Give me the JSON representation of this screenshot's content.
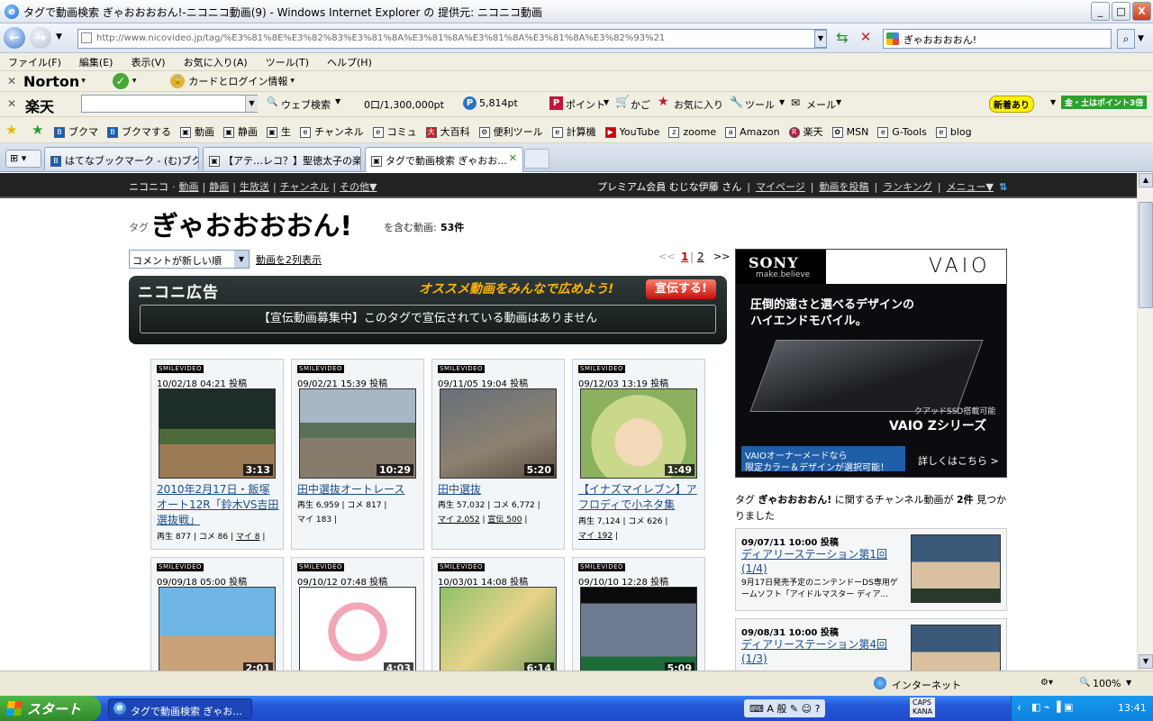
{
  "window": {
    "title": "タグで動画検索 ぎゃおおおおん!-ニコニコ動画(9) - Windows Internet Explorer の 提供元: ニコニコ動画",
    "minimize": "_",
    "maximize": "□",
    "close": "X"
  },
  "address": {
    "url": "http://www.nicovideo.jp/tag/%E3%81%8E%E3%82%83%E3%81%8A%E3%81%8A%E3%81%8A%E3%81%8A%E3%82%93%21",
    "search_value": "ぎゃおおおおん!"
  },
  "menu": [
    "ファイル(F)",
    "編集(E)",
    "表示(V)",
    "お気に入り(A)",
    "ツール(T)",
    "ヘルプ(H)"
  ],
  "norton_bar": {
    "brand": "Norton",
    "card_label": "カードとログイン情報"
  },
  "rakuten_bar": {
    "brand": "楽天",
    "web_search": "ウェブ検索",
    "points": "0口/1,300,000pt",
    "pt": "5,814pt",
    "point_label": "ポイント",
    "cart": "かご",
    "favorites": "お気に入り",
    "tools": "ツール",
    "mail": "メール",
    "new_badge": "新着あり",
    "promo": "金・土はポイント3倍"
  },
  "favorites_bar": [
    "ブクマ",
    "ブクマする",
    "動画",
    "静画",
    "生",
    "チャンネル",
    "コミュ",
    "大百科",
    "便利ツール",
    "計算機",
    "YouTube",
    "zoome",
    "Amazon",
    "楽天",
    "MSN",
    "G-Tools",
    "blog"
  ],
  "tabs": [
    {
      "label": "はてなブックマーク - (む)ブクマ..."
    },
    {
      "label": "【アテ…レコ？】聖徳太子の楽..."
    },
    {
      "label": "タグで動画検索 ぎゃおお..."
    }
  ],
  "site_nav": {
    "left": [
      "ニコニコ",
      "動画",
      "静画",
      "生放送",
      "チャンネル",
      "その他▼"
    ],
    "user_text": "プレミアム会員 むじな伊藤 さん",
    "right": [
      "マイページ",
      "動画を投稿",
      "ランキング",
      "メニュー▼"
    ]
  },
  "tag_header": {
    "prefix": "タグ",
    "tag": "ぎゃおおおおん!",
    "count_label": "を含む動画:",
    "count": "53件"
  },
  "controls": {
    "sort_selected": "コメントが新しい順",
    "two_column": "動画を2列表示",
    "pager_prev": "<<",
    "pages": [
      "1",
      "2"
    ],
    "pager_next": ">>"
  },
  "ad_banner": {
    "heading": "ニコニ広告",
    "promo": "オススメ動画をみんなで広めよう!",
    "send_button": "宣伝する!",
    "message": "【宣伝動画募集中】このタグで宣伝されている動画はありません"
  },
  "badge_text": "SMILEVIDEO",
  "videos_row1": [
    {
      "date": "10/02/18 04:21 投稿",
      "length": "3:13",
      "title": "2010年2月17日・飯塚オート12R「鈴木VS吉田選抜戦」",
      "stats": [
        "再生 877",
        "コメ 86",
        "マイ 8"
      ],
      "thumb": "race"
    },
    {
      "date": "09/02/21 15:39 投稿",
      "length": "10:29",
      "title": "田中選抜オートレース",
      "stats": [
        "再生 6,959",
        "コメ 817",
        "マイ 183"
      ],
      "thumb": "track"
    },
    {
      "date": "09/11/05 19:04 投稿",
      "length": "5:20",
      "title": "田中選抜",
      "stats": [
        "再生 57,032",
        "コメ 6,772",
        "マイ 2,052",
        "宣伝 500"
      ],
      "thumb": "race"
    },
    {
      "date": "09/12/03 13:19 投稿",
      "length": "1:49",
      "title": "【イナズマイレブン】アフロディで小ネタ集",
      "stats": [
        "再生 7,124",
        "コメ 626",
        "マイ 192"
      ],
      "thumb": "anime"
    }
  ],
  "videos_row2": [
    {
      "date": "09/09/18 05:00 投稿",
      "length": "2:01",
      "thumb": "idol1"
    },
    {
      "date": "09/10/12 07:48 投稿",
      "length": "4:03",
      "thumb": "idol2"
    },
    {
      "date": "10/03/01 14:08 投稿",
      "length": "6:14",
      "thumb": "idol3"
    },
    {
      "date": "09/10/10 12:28 投稿",
      "length": "5:09",
      "thumb": "idol4"
    }
  ],
  "sony_ad": {
    "brand": "SONY",
    "tagline": "make.believe",
    "product": "VAIO",
    "headline1": "圧倒的速さと選べるデザインの",
    "headline2": "ハイエンドモバイル。",
    "ssd": "クアッドSSD搭載可能",
    "series": "VAIO Zシリーズ",
    "foot1": "VAIOオーナーメードなら",
    "foot2": "限定カラー＆デザインが選択可能！",
    "more": "詳しくはこちら >"
  },
  "channel_section": {
    "text_prefix": "タグ",
    "tag": "ぎゃおおおおん!",
    "text_mid": "に関するチャンネル動画が",
    "count": "2件",
    "text_suffix": "見つかりました",
    "items": [
      {
        "date": "09/07/11 10:00 投稿",
        "title": "ディアリーステーション第1回(1/4)",
        "desc": "9月17日発売予定のニンテンドーDS専用ゲームソフト「アイドルマスター ディア..."
      },
      {
        "date": "09/08/31 10:00 投稿",
        "title": "ディアリーステーション第4回(1/3)",
        "desc": ""
      }
    ]
  },
  "statusbar": {
    "zone": "インターネット",
    "zoom": "100%"
  },
  "taskbar": {
    "start": "スタート",
    "item": "タグで動画検索 ぎゃお...",
    "ime": "A 般",
    "caps": "CAPS",
    "kana": "KANA",
    "time": "13:41"
  }
}
